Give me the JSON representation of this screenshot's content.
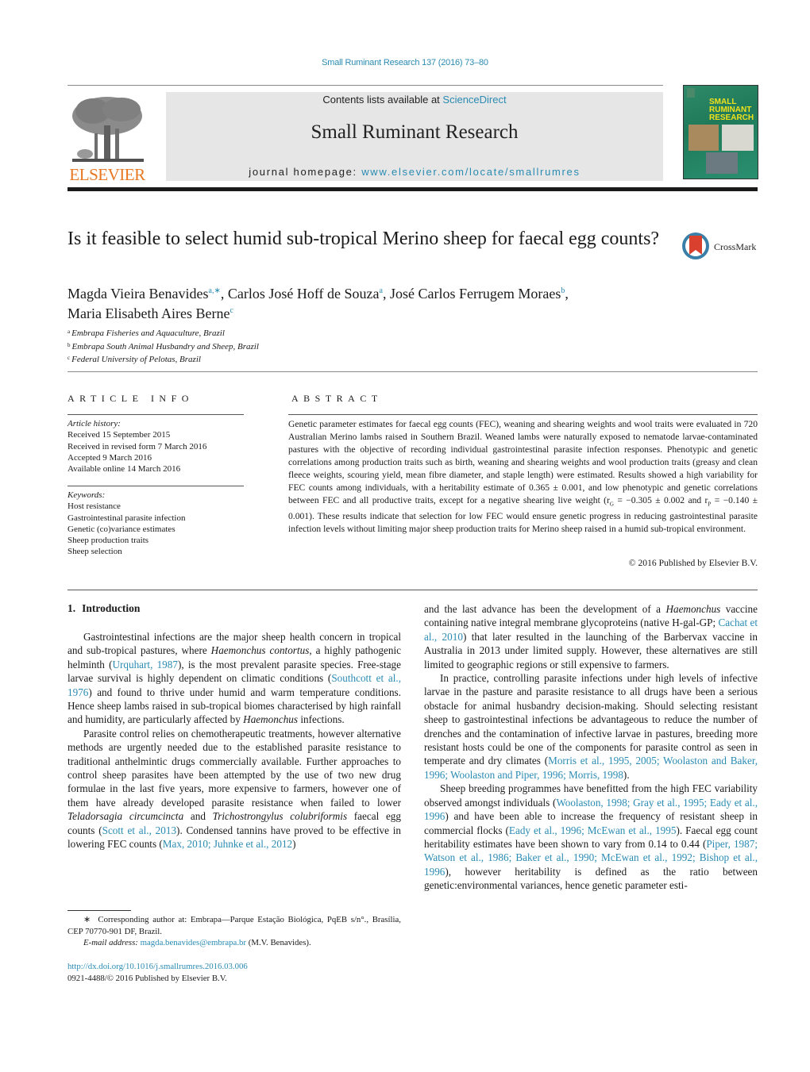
{
  "header": {
    "journal_ref": "Small Ruminant Research 137 (2016) 73–80",
    "contents_prefix": "Contents lists available at ",
    "contents_link": "ScienceDirect",
    "journal_title": "Small Ruminant Research",
    "homepage_prefix": "journal homepage: ",
    "homepage_link": "www.elsevier.com/locate/smallrumres",
    "publisher_logo": "ELSEVIER",
    "cover": {
      "title_lines": [
        "SMALL",
        "RUMINANT",
        "RESEARCH"
      ]
    },
    "crossmark_label": "CrossMark"
  },
  "article": {
    "title": "Is it feasible to select humid sub-tropical Merino sheep for faecal egg counts?",
    "authors": [
      {
        "name": "Magda Vieira Benavides",
        "sup": "a,∗",
        "sep": ", "
      },
      {
        "name": "Carlos José Hoff de Souza",
        "sup": "a",
        "sep": ", "
      },
      {
        "name": "José Carlos Ferrugem Moraes",
        "sup": "b",
        "sep": ","
      },
      {
        "name": "Maria Elisabeth Aires Berne",
        "sup": "c",
        "sep": ""
      }
    ],
    "affiliations": [
      {
        "key": "a",
        "text": "Embrapa Fisheries and Aquaculture, Brazil"
      },
      {
        "key": "b",
        "text": "Embrapa South Animal Husbandry and Sheep, Brazil"
      },
      {
        "key": "c",
        "text": "Federal University of Pelotas, Brazil"
      }
    ]
  },
  "article_info": {
    "heading": "ARTICLE INFO",
    "history_label": "Article history:",
    "history": [
      "Received 15 September 2015",
      "Received in revised form 7 March 2016",
      "Accepted 9 March 2016",
      "Available online 14 March 2016"
    ],
    "keywords_label": "Keywords:",
    "keywords": [
      "Host resistance",
      "Gastrointestinal parasite infection",
      "Genetic (co)variance estimates",
      "Sheep production traits",
      "Sheep selection"
    ]
  },
  "abstract": {
    "heading": "ABSTRACT",
    "text_1": "Genetic parameter estimates for faecal egg counts (FEC), weaning and shearing weights and wool traits were evaluated in 720 Australian Merino lambs raised in Southern Brazil. Weaned lambs were naturally exposed to nematode larvae-contaminated pastures with the objective of recording individual gastrointestinal parasite infection responses. Phenotypic and genetic correlations among production traits such as birth, weaning and shearing weights and wool production traits (greasy and clean fleece weights, scouring yield, mean fibre diameter, and staple length) were estimated. Results showed a high variability for FEC counts among individuals, with a heritability estimate of 0.365 ± 0.001, and low phenotypic and genetic correlations between FEC and all productive traits, except for a negative shearing live weight (r",
    "sub_g": "G",
    "text_2": " = −0.305 ± 0.002 and r",
    "sub_p": "P",
    "text_3": " = −0.140 ± 0.001). These results indicate that selection for low FEC would ensure genetic progress in reducing gastrointestinal parasite infection levels without limiting major sheep production traits for Merino sheep raised in a humid sub-tropical environment.",
    "copyright": "© 2016 Published by Elsevier B.V."
  },
  "introduction": {
    "number": "1.",
    "heading": "Introduction",
    "p1": [
      {
        "t": "Gastrointestinal infections are the major sheep health concern in tropical and sub-tropical pastures, where "
      },
      {
        "i": "Haemonchus contortus"
      },
      {
        "t": ", a highly pathogenic helminth ("
      },
      {
        "l": "Urquhart, 1987"
      },
      {
        "t": "), is the most prevalent parasite species. Free-stage larvae survival is highly dependent on climatic conditions ("
      },
      {
        "l": "Southcott et al., 1976"
      },
      {
        "t": ") and found to thrive under humid and warm temperature conditions. Hence sheep lambs raised in sub-tropical biomes characterised by high rainfall and humidity, are particularly affected by "
      },
      {
        "i": "Haemonchus"
      },
      {
        "t": " infections."
      }
    ],
    "p2": [
      {
        "t": "Parasite control relies on chemotherapeutic treatments, however alternative methods are urgently needed due to the established parasite resistance to traditional anthelmintic drugs commercially available. Further approaches to control sheep parasites have been attempted by the use of two new drug formulae in the last five years, more expensive to farmers, however one of them have already developed parasite resistance when failed to lower "
      },
      {
        "i": "Teladorsagia circumcincta"
      },
      {
        "t": " and "
      },
      {
        "i": "Trichostrongylus colubriformis"
      },
      {
        "t": " faecal egg counts ("
      },
      {
        "l": "Scott et al., 2013"
      },
      {
        "t": "). Condensed tannins have proved to be effective in lowering FEC counts ("
      },
      {
        "l": "Max, 2010; Juhnke et al., 2012"
      },
      {
        "t": ")"
      }
    ],
    "p2_cont": [
      {
        "t": "and the last advance has been the development of a "
      },
      {
        "i": "Haemonchus"
      },
      {
        "t": " vaccine containing native integral membrane glycoproteins (native H-gal-GP; "
      },
      {
        "l": "Cachat et al., 2010"
      },
      {
        "t": ") that later resulted in the launching of the Barbervax vaccine in Australia in 2013 under limited supply. However, these alternatives are still limited to geographic regions or still expensive to farmers."
      }
    ],
    "p3": [
      {
        "t": "In practice, controlling parasite infections under high levels of infective larvae in the pasture and parasite resistance to all drugs have been a serious obstacle for animal husbandry decision-making. Should selecting resistant sheep to gastrointestinal infections be advantageous to reduce the number of drenches and the contamination of infective larvae in pastures, breeding more resistant hosts could be one of the components for parasite control as seen in temperate and dry climates ("
      },
      {
        "l": "Morris et al., 1995, 2005; Woolaston and Baker, 1996; Woolaston and Piper, 1996; Morris, 1998"
      },
      {
        "t": ")."
      }
    ],
    "p4": [
      {
        "t": "Sheep breeding programmes have benefitted from the high FEC variability observed amongst individuals ("
      },
      {
        "l": "Woolaston, 1998; Gray et al., 1995; Eady et al., 1996"
      },
      {
        "t": ") and have been able to increase the frequency of resistant sheep in commercial flocks ("
      },
      {
        "l": "Eady et al., 1996; McEwan et al., 1995"
      },
      {
        "t": "). Faecal egg count heritability estimates have been shown to vary from 0.14 to 0.44 ("
      },
      {
        "l": "Piper, 1987; Watson et al., 1986; Baker et al., 1990; McEwan et al., 1992; Bishop et al., 1996"
      },
      {
        "t": "), however heritability is defined as the ratio between genetic:environmental variances, hence genetic parameter esti-"
      }
    ]
  },
  "footnote": {
    "star": "∗",
    "text": "Corresponding author at: Embrapa—Parque Estação Biológica, PqEB s/n°., Brasília, CEP 70770-901 DF, Brazil.",
    "email_label": "E-mail address: ",
    "email": "magda.benavides@embrapa.br",
    "email_suffix": " (M.V. Benavides)."
  },
  "doi": {
    "link": "http://dx.doi.org/10.1016/j.smallrumres.2016.03.006",
    "issn_line": "0921-4488/© 2016 Published by Elsevier B.V."
  },
  "colors": {
    "link": "#2a8bb3",
    "elsevier_orange": "#e87722",
    "banner_gray": "#e6e6e6",
    "cover_green": "#2a8a68",
    "crossmark_red": "#d9412e",
    "crossmark_blue": "#3a7fa8"
  }
}
